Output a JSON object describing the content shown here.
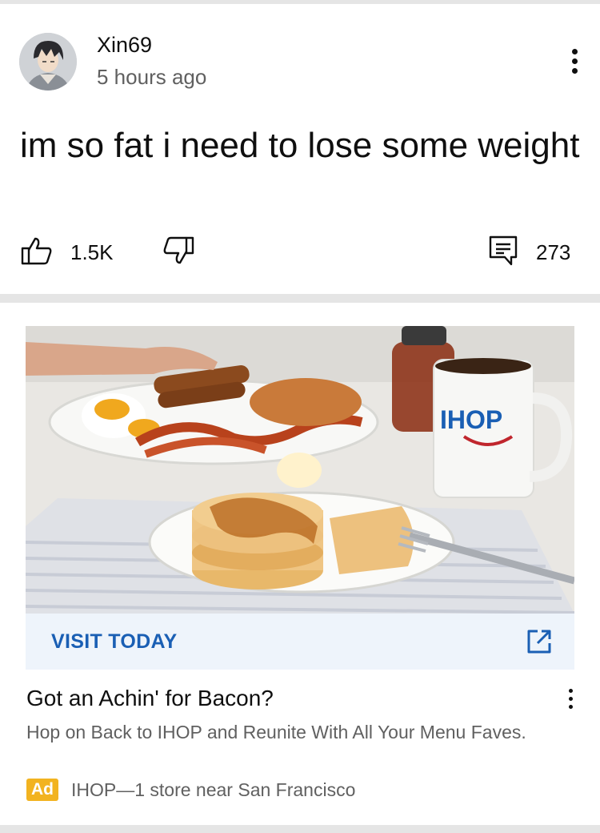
{
  "post": {
    "username": "Xin69",
    "time": "5 hours ago",
    "text": "im so fat i need to lose some weight",
    "likes": "1.5K",
    "comments": "273",
    "icons": {
      "avatar": "avatar-anime-character",
      "more": "more-vert-icon",
      "like": "thumbs-up-icon",
      "dislike": "thumbs-down-icon",
      "comment": "comment-icon"
    }
  },
  "ad": {
    "image": "ihop-breakfast-photo",
    "image_mug_text": "IHOP",
    "cta_label": "VISIT TODAY",
    "title": "Got an Achin' for Bacon?",
    "description": "Hop on Back to IHOP and Reunite With All Your Menu Faves.",
    "badge": "Ad",
    "source": "IHOP—1 store near San Francisco",
    "icons": {
      "cta": "open-in-new-icon",
      "more": "more-vert-icon"
    },
    "colors": {
      "cta_text": "#1a5fb4",
      "cta_bg": "#eef4fb",
      "badge_bg": "#f2b320"
    }
  }
}
